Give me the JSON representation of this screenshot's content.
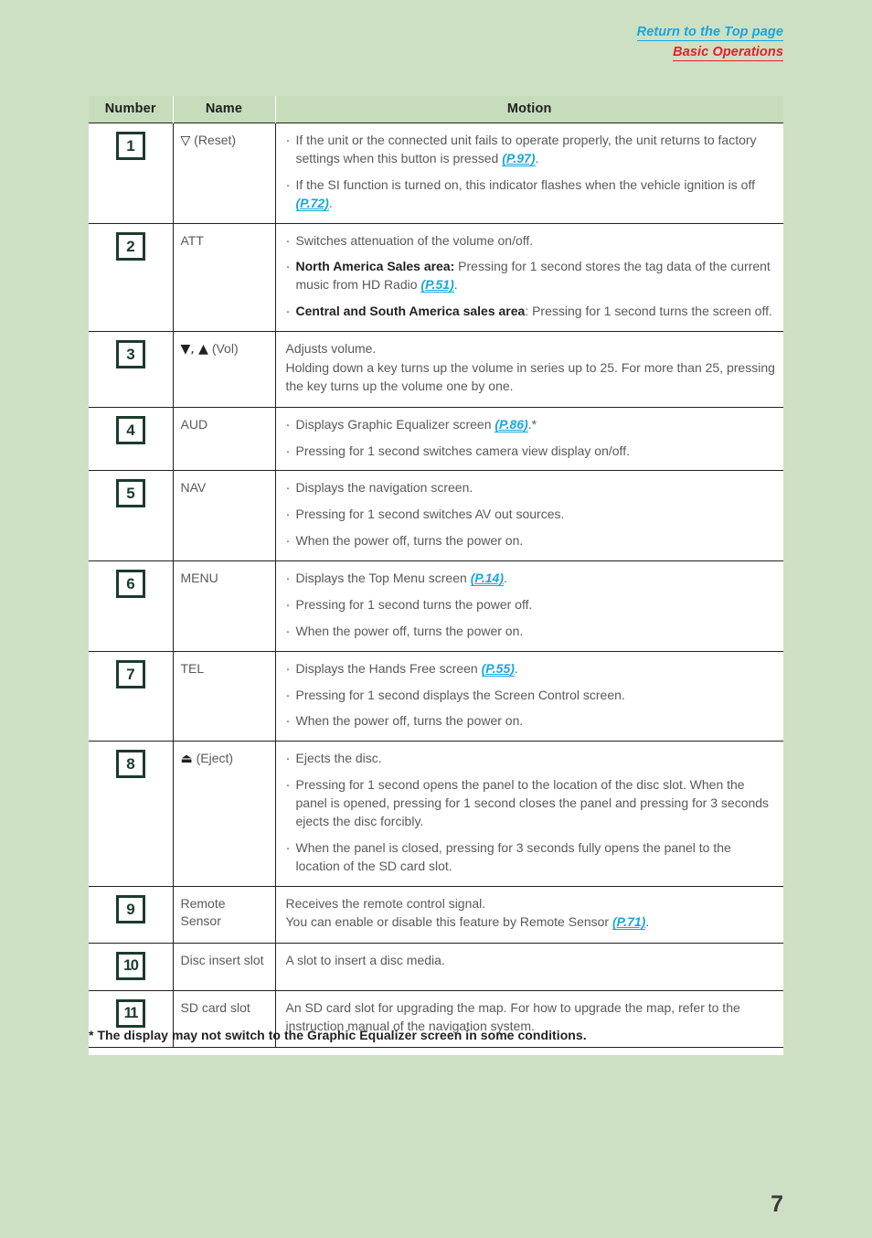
{
  "header": {
    "top_link": "Return to the Top page",
    "section_link": "Basic Operations",
    "top_link_color": "#16a6dd",
    "section_link_color": "#e32028"
  },
  "page": {
    "background_color": "#cde0c4",
    "number": "7"
  },
  "table": {
    "columns": [
      "Number",
      "Name",
      "Motion"
    ],
    "header_background": "#c7dcbb",
    "badge_color": "#1c3b2c",
    "rows": [
      {
        "number": "1",
        "name_glyph": "▽",
        "name": "(Reset)",
        "lines": [
          {
            "bullet": true,
            "parts": [
              {
                "text": "If the unit or the connected unit fails to operate properly, the unit returns to factory settings when this button is pressed "
              },
              {
                "text": "(P.97)",
                "style": "pageref"
              },
              {
                "text": "."
              }
            ]
          },
          {
            "bullet": true,
            "parts": [
              {
                "text": "If the SI function is turned on, this indicator flashes when the vehicle ignition is off "
              },
              {
                "text": "(P.72)",
                "style": "pageref"
              },
              {
                "text": "."
              }
            ]
          }
        ]
      },
      {
        "number": "2",
        "name_glyph": "",
        "name": "ATT",
        "lines": [
          {
            "bullet": true,
            "parts": [
              {
                "text": "Switches attenuation of the volume on/off."
              }
            ]
          },
          {
            "bullet": true,
            "parts": [
              {
                "text": "North America Sales area:",
                "style": "bold"
              },
              {
                "text": " Pressing for 1 second stores the tag data of the current music from HD Radio "
              },
              {
                "text": "(P.51)",
                "style": "pageref"
              },
              {
                "text": "."
              }
            ]
          },
          {
            "bullet": true,
            "parts": [
              {
                "text": "Central and South America sales area",
                "style": "bold"
              },
              {
                "text": ": Pressing for 1 second turns the screen off."
              }
            ]
          }
        ]
      },
      {
        "number": "3",
        "name_glyph": "▼, ▲",
        "name": "(Vol)",
        "lines": [
          {
            "bullet": false,
            "parts": [
              {
                "text": "Adjusts volume."
              }
            ]
          },
          {
            "bullet": false,
            "parts": [
              {
                "text": "Holding down a key turns up the volume in series up to 25. For more than 25, pressing the key turns up the volume one by one."
              }
            ]
          }
        ]
      },
      {
        "number": "4",
        "name_glyph": "",
        "name": "AUD",
        "lines": [
          {
            "bullet": true,
            "parts": [
              {
                "text": "Displays Graphic Equalizer screen "
              },
              {
                "text": "(P.86)",
                "style": "pageref"
              },
              {
                "text": ".*"
              }
            ]
          },
          {
            "bullet": true,
            "parts": [
              {
                "text": "Pressing for 1 second switches camera view display on/off."
              }
            ]
          }
        ]
      },
      {
        "number": "5",
        "name_glyph": "",
        "name": "NAV",
        "lines": [
          {
            "bullet": true,
            "parts": [
              {
                "text": "Displays the navigation screen."
              }
            ]
          },
          {
            "bullet": true,
            "parts": [
              {
                "text": "Pressing for 1 second switches AV out sources."
              }
            ]
          },
          {
            "bullet": true,
            "parts": [
              {
                "text": "When the power off, turns the power on."
              }
            ]
          }
        ]
      },
      {
        "number": "6",
        "name_glyph": "",
        "name": "MENU",
        "lines": [
          {
            "bullet": true,
            "parts": [
              {
                "text": "Displays the Top Menu screen "
              },
              {
                "text": "(P.14)",
                "style": "pageref"
              },
              {
                "text": "."
              }
            ]
          },
          {
            "bullet": true,
            "parts": [
              {
                "text": "Pressing for 1 second turns the power off."
              }
            ]
          },
          {
            "bullet": true,
            "parts": [
              {
                "text": "When the power off, turns the power on."
              }
            ]
          }
        ]
      },
      {
        "number": "7",
        "name_glyph": "",
        "name": "TEL",
        "lines": [
          {
            "bullet": true,
            "parts": [
              {
                "text": "Displays the Hands Free screen "
              },
              {
                "text": "(P.55)",
                "style": "pageref"
              },
              {
                "text": "."
              }
            ]
          },
          {
            "bullet": true,
            "parts": [
              {
                "text": "Pressing for 1 second displays the Screen Control screen."
              }
            ]
          },
          {
            "bullet": true,
            "parts": [
              {
                "text": "When the power off, turns the power on."
              }
            ]
          }
        ]
      },
      {
        "number": "8",
        "name_glyph": "⏏",
        "name": "(Eject)",
        "lines": [
          {
            "bullet": true,
            "parts": [
              {
                "text": "Ejects the disc."
              }
            ]
          },
          {
            "bullet": true,
            "parts": [
              {
                "text": "Pressing for 1 second opens the panel to the location of the disc slot. When the panel is opened, pressing for 1 second closes the panel and pressing for 3 seconds ejects the disc forcibly."
              }
            ]
          },
          {
            "bullet": true,
            "parts": [
              {
                "text": "When the panel is closed, pressing for 3 seconds fully opens the panel to the location of the SD card slot."
              }
            ]
          }
        ]
      },
      {
        "number": "9",
        "name_glyph": "",
        "name": "Remote Sensor",
        "lines": [
          {
            "bullet": false,
            "parts": [
              {
                "text": "Receives the remote control signal."
              }
            ]
          },
          {
            "bullet": false,
            "parts": [
              {
                "text": "You can enable or disable this feature by Remote Sensor "
              },
              {
                "text": "(P.71)",
                "style": "pageref"
              },
              {
                "text": "."
              }
            ]
          }
        ]
      },
      {
        "number": "10",
        "name_glyph": "",
        "name": "Disc insert slot",
        "lines": [
          {
            "bullet": false,
            "parts": [
              {
                "text": "A slot to insert a disc media."
              }
            ]
          }
        ]
      },
      {
        "number": "11",
        "name_glyph": "",
        "name": "SD card slot",
        "lines": [
          {
            "bullet": false,
            "parts": [
              {
                "text": "An SD card slot for upgrading the map. For how to upgrade the map, refer to the instruction manual of the navigation system."
              }
            ]
          }
        ]
      }
    ]
  },
  "footnote": "* The display may not switch to the Graphic Equalizer screen in some conditions."
}
